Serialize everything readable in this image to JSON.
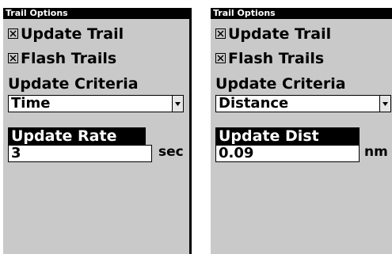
{
  "left_panel": {
    "title": "Trail Options",
    "update_trail_label": "Update Trail",
    "flash_trails_label": "Flash Trails",
    "update_criteria_label": "Update Criteria",
    "criteria_value": "Time",
    "rate_label": "Update Rate",
    "rate_value": "3",
    "rate_unit": "sec"
  },
  "right_panel": {
    "title": "Trail Options",
    "update_trail_label": "Update Trail",
    "flash_trails_label": "Flash Trails",
    "update_criteria_label": "Update Criteria",
    "criteria_value": "Distance",
    "dist_label": "Update Dist",
    "dist_value": "0.09",
    "dist_unit": "nm"
  },
  "icons": {
    "checkbox": "checked-x-checkbox-icon",
    "dropdown": "triangle-down-icon"
  },
  "colors": {
    "panel_bg": "#c9c9c9",
    "highlight": "#000000",
    "field_bg": "#ffffff"
  }
}
